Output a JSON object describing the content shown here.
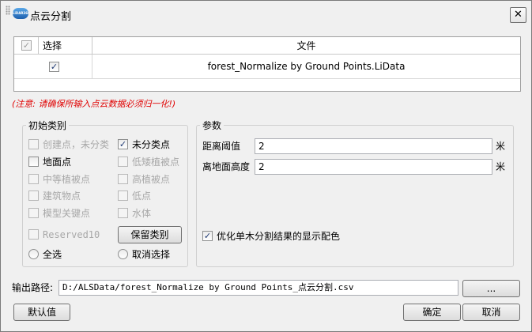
{
  "window": {
    "title": "点云分割",
    "logo_text": "LiDAR360",
    "close_glyph": "✕"
  },
  "file_table": {
    "columns": {
      "select": "选择",
      "file": "文件"
    },
    "rows": [
      {
        "selected": true,
        "file": "forest_Normalize by Ground Points.LiData"
      }
    ]
  },
  "warning": "(注意: 请确保所输入点云数据必须归一化!)",
  "initial_classes": {
    "title": "初始类别",
    "items": [
      {
        "label": "创建点，未分类",
        "checked": false,
        "enabled": false
      },
      {
        "label": "未分类点",
        "checked": true,
        "enabled": true
      },
      {
        "label": "地面点",
        "checked": false,
        "enabled": true
      },
      {
        "label": "低矮植被点",
        "checked": false,
        "enabled": false
      },
      {
        "label": "中等植被点",
        "checked": false,
        "enabled": false
      },
      {
        "label": "高植被点",
        "checked": false,
        "enabled": false
      },
      {
        "label": "建筑物点",
        "checked": false,
        "enabled": false
      },
      {
        "label": "低点",
        "checked": false,
        "enabled": false
      },
      {
        "label": "模型关键点",
        "checked": false,
        "enabled": false
      },
      {
        "label": "水体",
        "checked": false,
        "enabled": false
      },
      {
        "label": "Reserved10",
        "checked": false,
        "enabled": false
      }
    ],
    "keep_classes_button": "保留类别",
    "select_all": "全选",
    "deselect": "取消选择"
  },
  "params": {
    "title": "参数",
    "distance_threshold": {
      "label": "距离阈值",
      "value": "2",
      "unit": "米"
    },
    "height_above_ground": {
      "label": "离地面高度",
      "value": "2",
      "unit": "米"
    },
    "optimize_color": {
      "label": "优化单木分割结果的显示配色",
      "checked": true
    }
  },
  "output": {
    "label": "输出路径:",
    "value": "D:/ALSData/forest_Normalize by Ground Points_点云分割.csv",
    "browse": "..."
  },
  "buttons": {
    "default": "默认值",
    "ok": "确定",
    "cancel": "取消"
  }
}
